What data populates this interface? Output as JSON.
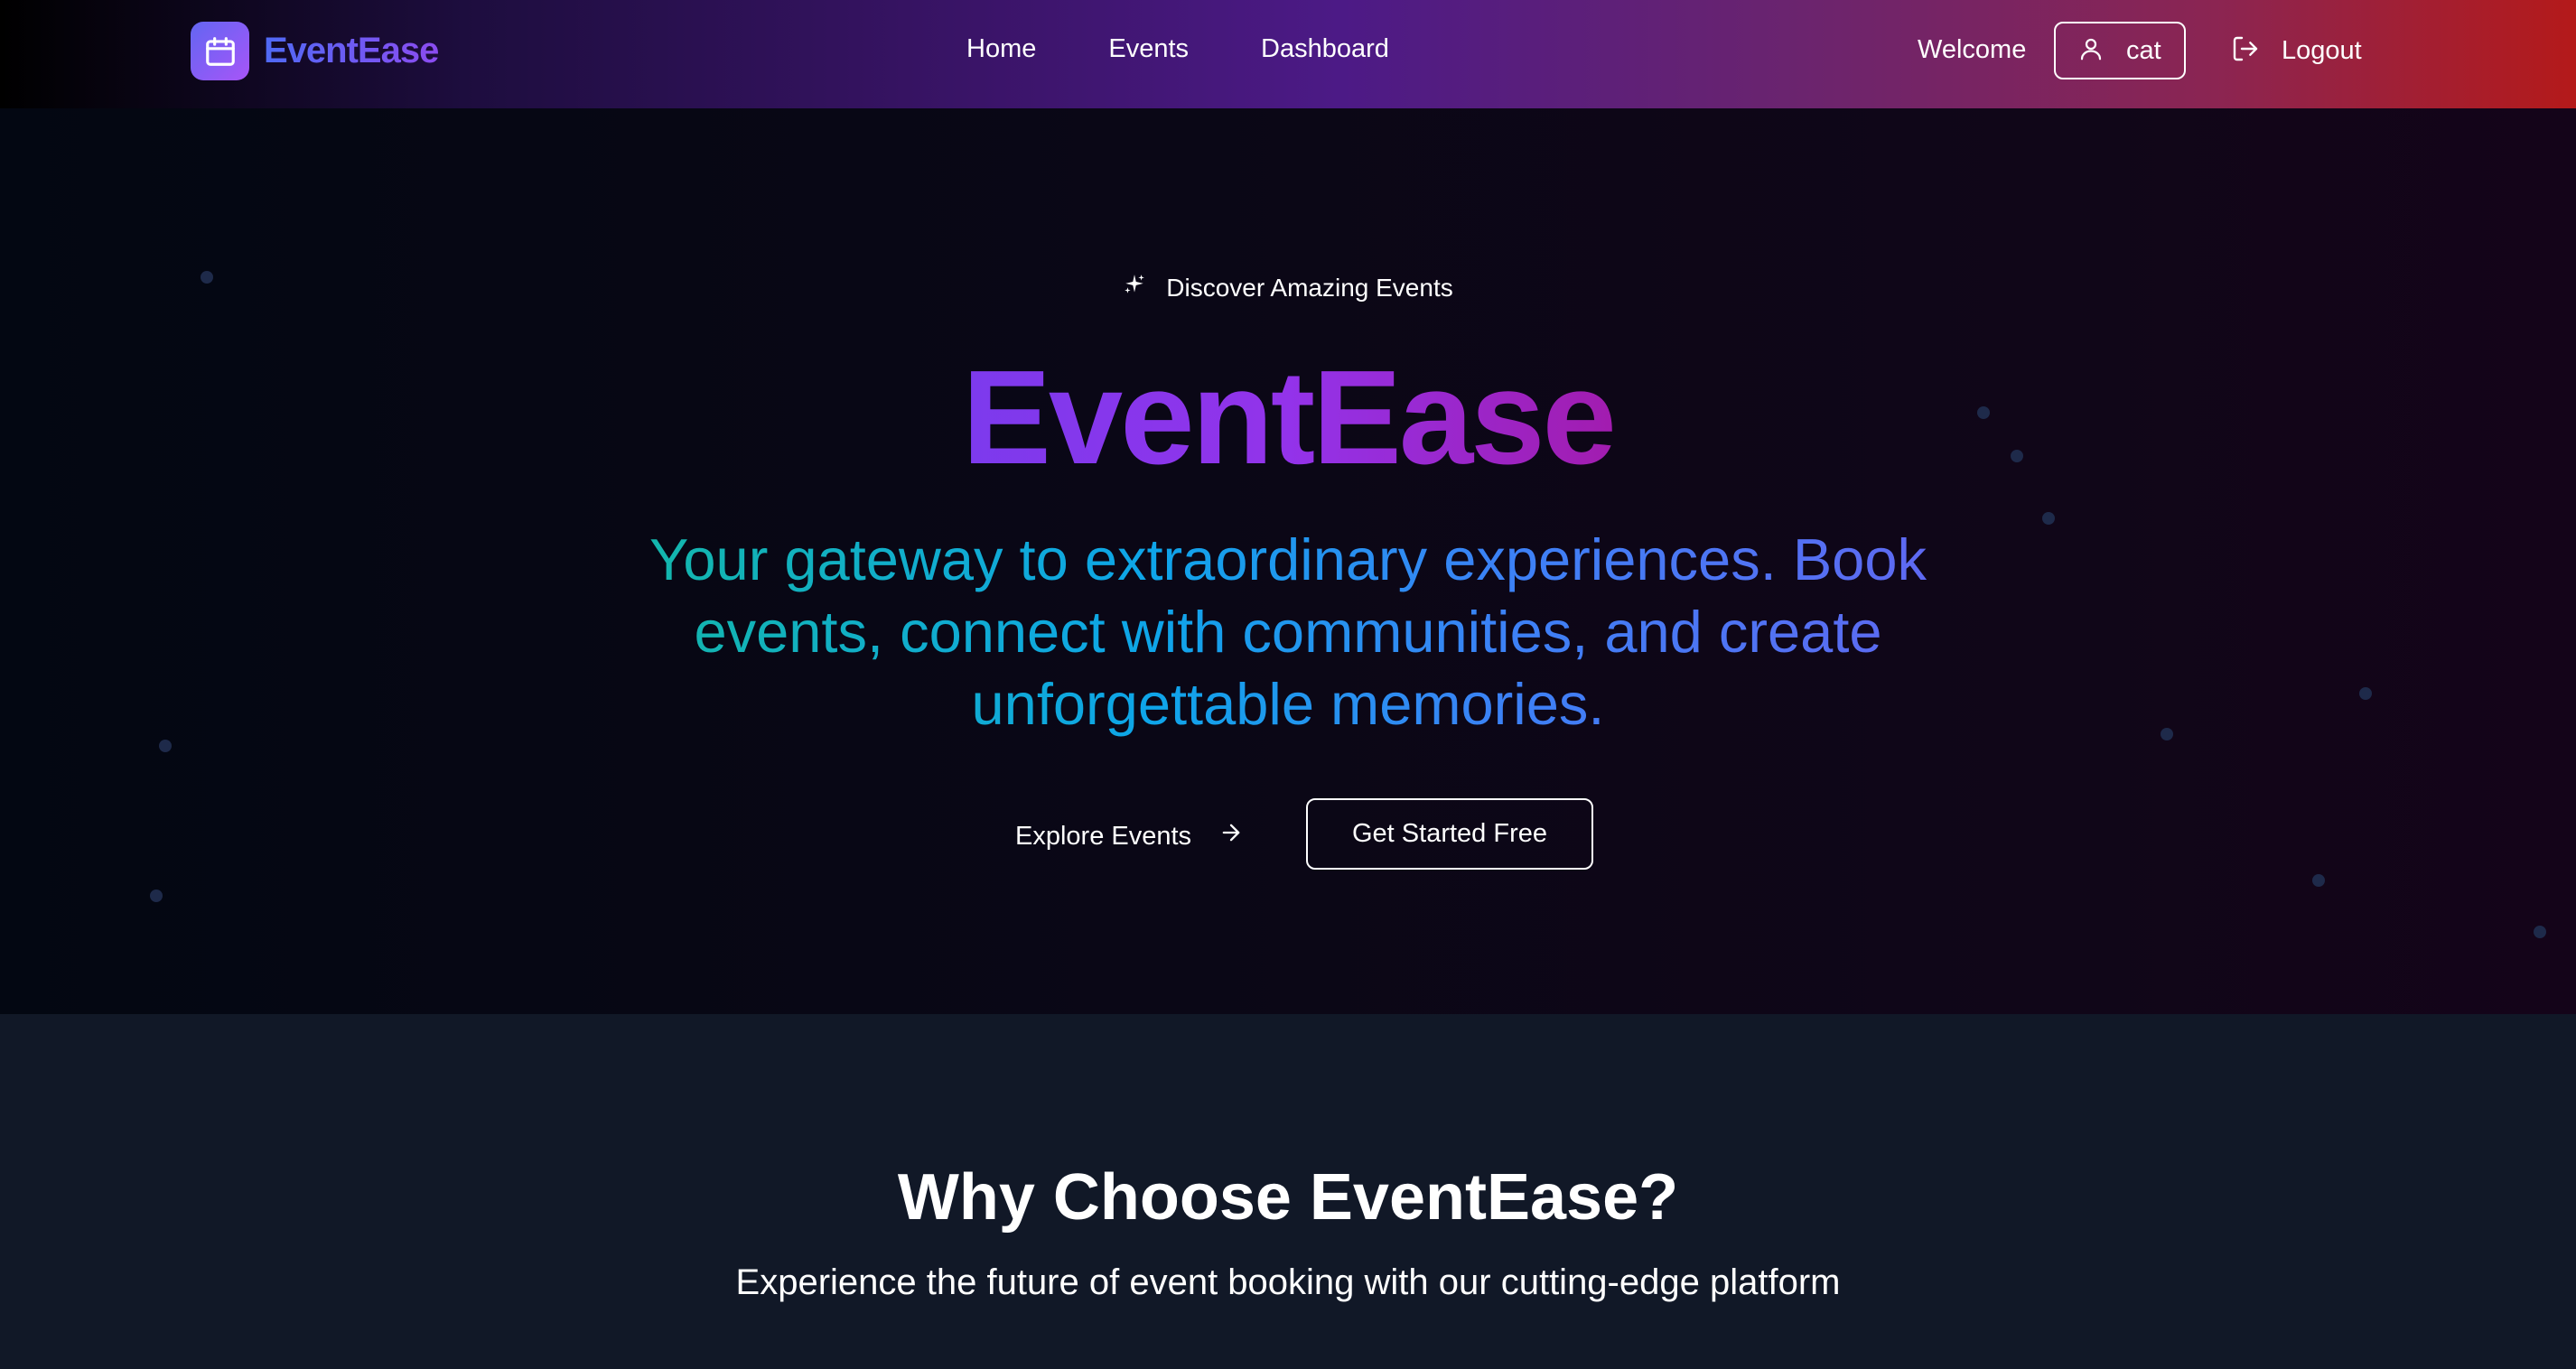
{
  "navbar": {
    "brand": "EventEase",
    "links": [
      "Home",
      "Events",
      "Dashboard"
    ],
    "welcome": "Welcome",
    "username": "cat",
    "logout": "Logout"
  },
  "hero": {
    "kicker": "Discover Amazing Events",
    "title": "EventEase",
    "subtitle": "Your gateway to extraordinary experiences. Book events, connect with communities, and create unforgettable memories.",
    "explore_button": "Explore Events",
    "start_button": "Get Started Free"
  },
  "features": {
    "title": "Why Choose EventEase?",
    "subtitle": "Experience the future of event booking with our cutting-edge platform"
  },
  "icons": {
    "logo": "calendar-icon",
    "user": "user-icon",
    "logout": "logout-icon",
    "kicker": "sparkles-icon",
    "arrow": "arrow-right-icon"
  },
  "colors": {
    "brand_purple": "#9333ea",
    "brand_indigo": "#6366f1",
    "subtitle_teal": "#14b8a6",
    "nav_red": "#b41a1a",
    "section_bg": "#111827"
  }
}
